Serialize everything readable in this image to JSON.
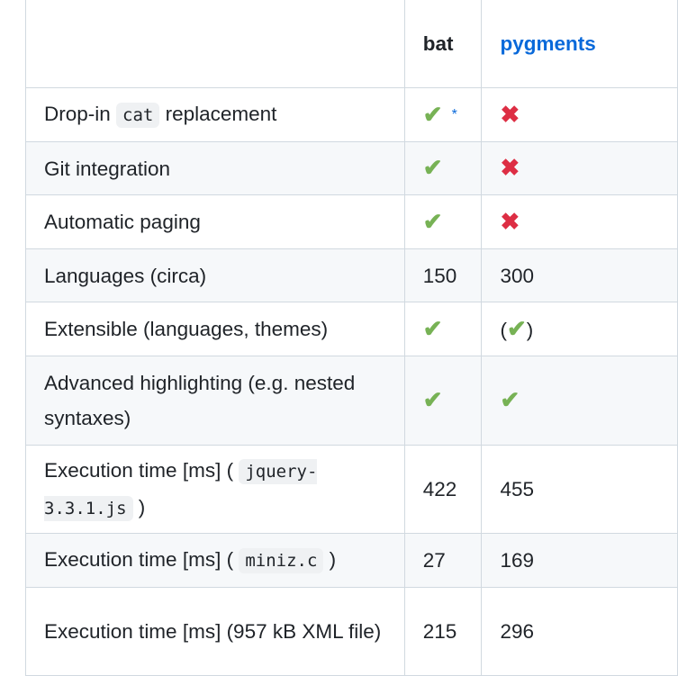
{
  "header": [
    "",
    "bat",
    "pygments"
  ],
  "colors": {
    "check": "#77b255",
    "cross": "#dd2e44",
    "link": "#0969da"
  },
  "rows": [
    {
      "feature": [
        {
          "t": "Drop-in "
        },
        {
          "code": "cat"
        },
        {
          "t": " replacement"
        }
      ],
      "bat": {
        "icon": "check",
        "note": "*"
      },
      "pygments": {
        "icon": "cross"
      },
      "h": 60
    },
    {
      "feature": [
        {
          "t": "Git integration"
        }
      ],
      "bat": {
        "icon": "check"
      },
      "pygments": {
        "icon": "cross"
      },
      "h": 59
    },
    {
      "feature": [
        {
          "t": "Automatic paging"
        }
      ],
      "bat": {
        "icon": "check"
      },
      "pygments": {
        "icon": "cross"
      },
      "h": 60
    },
    {
      "feature": [
        {
          "t": "Languages (circa)"
        }
      ],
      "bat": {
        "text": "150"
      },
      "pygments": {
        "text": "300"
      },
      "h": 59
    },
    {
      "feature": [
        {
          "t": "Extensible (languages, themes)"
        }
      ],
      "bat": {
        "icon": "check"
      },
      "pygments": {
        "icon": "check",
        "paren": true
      },
      "h": 60
    },
    {
      "feature": [
        {
          "t": "Advanced highlighting (e.g. nested syntaxes)"
        }
      ],
      "bat": {
        "icon": "check"
      },
      "pygments": {
        "icon": "check"
      },
      "h": 99
    },
    {
      "feature": [
        {
          "t": "Execution time [ms] ( "
        },
        {
          "code": "jquery-3.3.1.js"
        },
        {
          "t": " )"
        }
      ],
      "bat": {
        "text": "422"
      },
      "pygments": {
        "text": "455"
      },
      "h": 98
    },
    {
      "feature": [
        {
          "t": "Execution time [ms] ( "
        },
        {
          "code": "miniz.c"
        },
        {
          "t": " )"
        }
      ],
      "bat": {
        "text": "27"
      },
      "pygments": {
        "text": "169"
      },
      "h": 60
    },
    {
      "feature": [
        {
          "t": "Execution time [ms] (957 kB XML file)"
        }
      ],
      "bat": {
        "text": "215"
      },
      "pygments": {
        "text": "296"
      },
      "h": 98
    }
  ]
}
